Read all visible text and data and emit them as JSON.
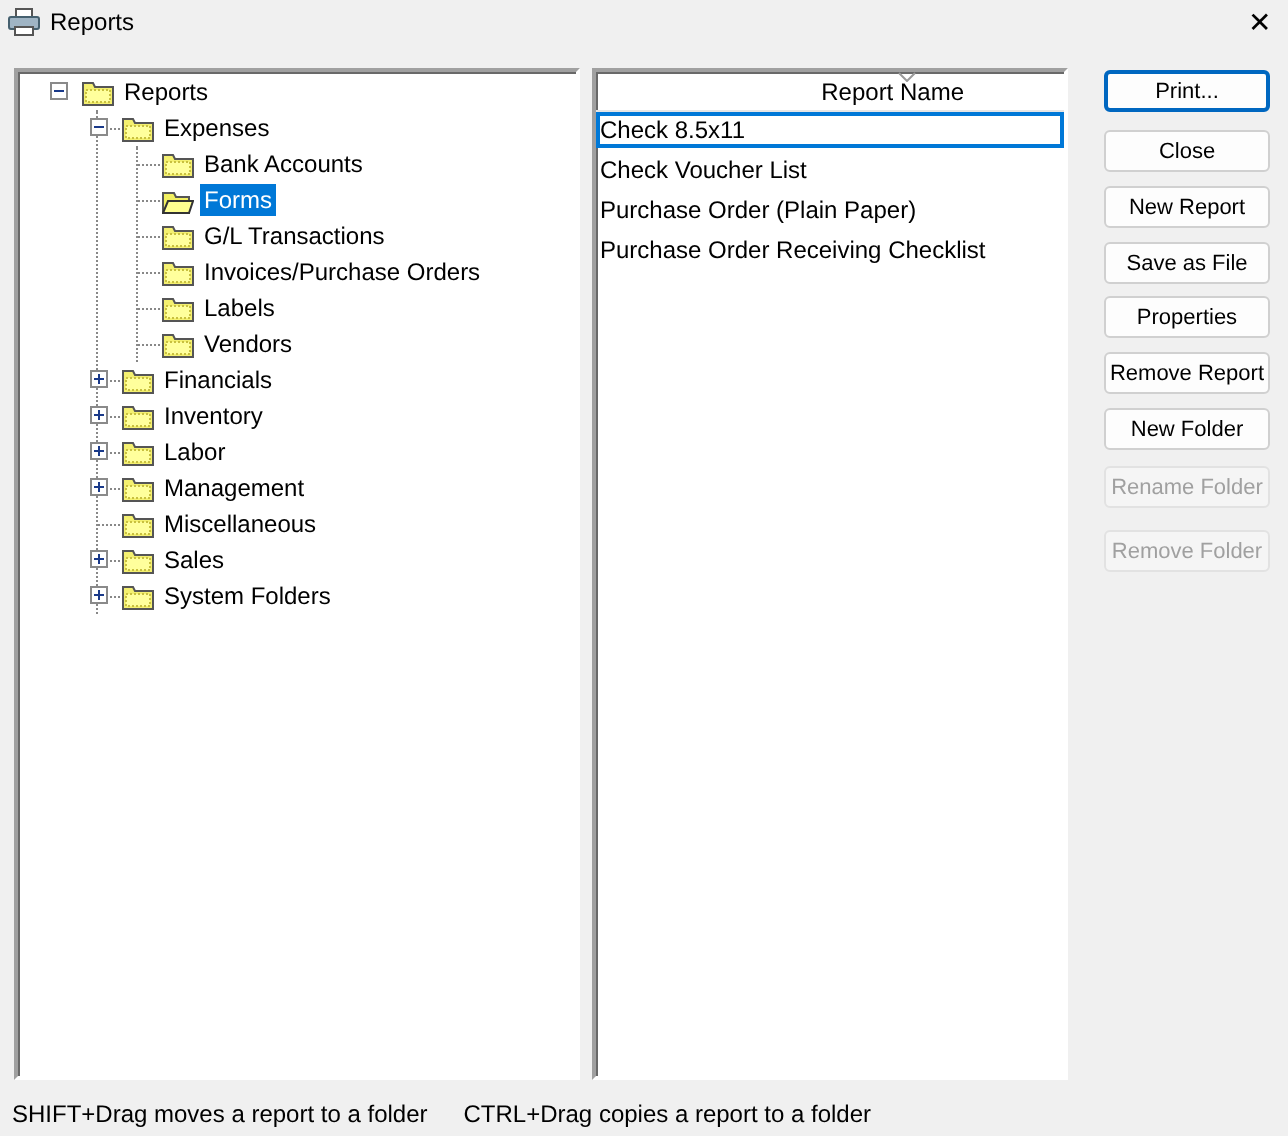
{
  "window": {
    "title": "Reports",
    "close": "✕"
  },
  "tree": [
    {
      "label": "Reports",
      "expanded": true,
      "selected": false,
      "children": [
        {
          "label": "Expenses",
          "expanded": true,
          "selected": false,
          "children": [
            {
              "label": "Bank Accounts",
              "selected": false
            },
            {
              "label": "Forms",
              "selected": true
            },
            {
              "label": "G/L Transactions",
              "selected": false
            },
            {
              "label": "Invoices/Purchase Orders",
              "selected": false
            },
            {
              "label": "Labels",
              "selected": false
            },
            {
              "label": "Vendors",
              "selected": false
            }
          ]
        },
        {
          "label": "Financials",
          "expanded": false,
          "selected": false
        },
        {
          "label": "Inventory",
          "expanded": false,
          "selected": false
        },
        {
          "label": "Labor",
          "expanded": false,
          "selected": false
        },
        {
          "label": "Management",
          "expanded": false,
          "selected": false
        },
        {
          "label": "Miscellaneous",
          "selected": false
        },
        {
          "label": "Sales",
          "expanded": false,
          "selected": false
        },
        {
          "label": "System Folders",
          "expanded": false,
          "selected": false
        }
      ]
    }
  ],
  "report_list": {
    "column": "Report Name",
    "rows": [
      {
        "name": "Check 8.5x11",
        "selected": true
      },
      {
        "name": "Check Voucher List",
        "selected": false
      },
      {
        "name": "Purchase Order (Plain Paper)",
        "selected": false
      },
      {
        "name": "Purchase Order Receiving Checklist",
        "selected": false
      }
    ]
  },
  "buttons": [
    {
      "label": "Print...",
      "default": true,
      "disabled": false
    },
    {
      "label": "Close",
      "default": false,
      "disabled": false
    },
    {
      "label": "New Report",
      "default": false,
      "disabled": false
    },
    {
      "label": "Save as File",
      "default": false,
      "disabled": false
    },
    {
      "label": "Properties",
      "default": false,
      "disabled": false
    },
    {
      "label": "Remove Report",
      "default": false,
      "disabled": false
    },
    {
      "label": "New Folder",
      "default": false,
      "disabled": false
    },
    {
      "label": "Rename Folder",
      "default": false,
      "disabled": true
    },
    {
      "label": "Remove Folder",
      "default": false,
      "disabled": true
    }
  ],
  "status_bar": [
    "SHIFT+Drag moves a report to a folder",
    "CTRL+Drag copies a report to a folder"
  ]
}
